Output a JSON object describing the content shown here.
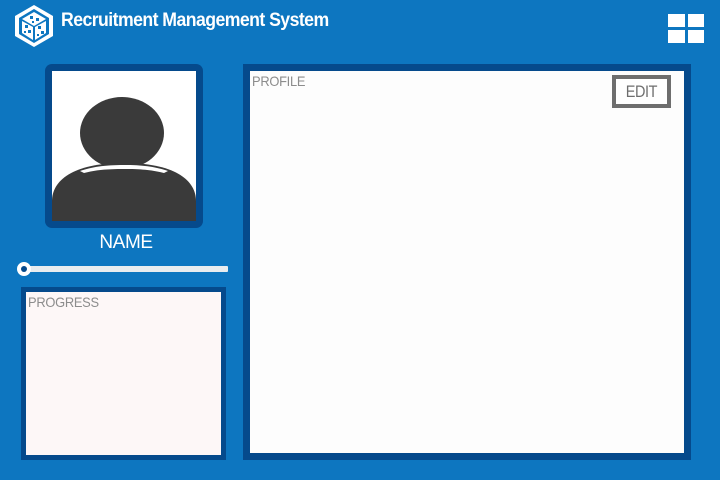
{
  "header": {
    "title": "Recruitment Management System",
    "logo_icon": "cube-logo-icon",
    "menu_icon": "grid-menu-icon"
  },
  "user": {
    "name": "NAME",
    "avatar_icon": "user-silhouette-icon",
    "progress": 0.0
  },
  "progress_panel": {
    "title": "PROGRESS"
  },
  "profile_panel": {
    "title": "PROFILE",
    "edit_label": "EDIT"
  },
  "colors": {
    "background": "#0d76c0",
    "panel_border": "#054a8c",
    "panel_fill": "#fdfdfd",
    "progress_fill": "#fdf7f7",
    "silhouette": "#3a3a3a",
    "muted_text": "#8c8c8c",
    "edit_border": "#6e6e6e"
  }
}
